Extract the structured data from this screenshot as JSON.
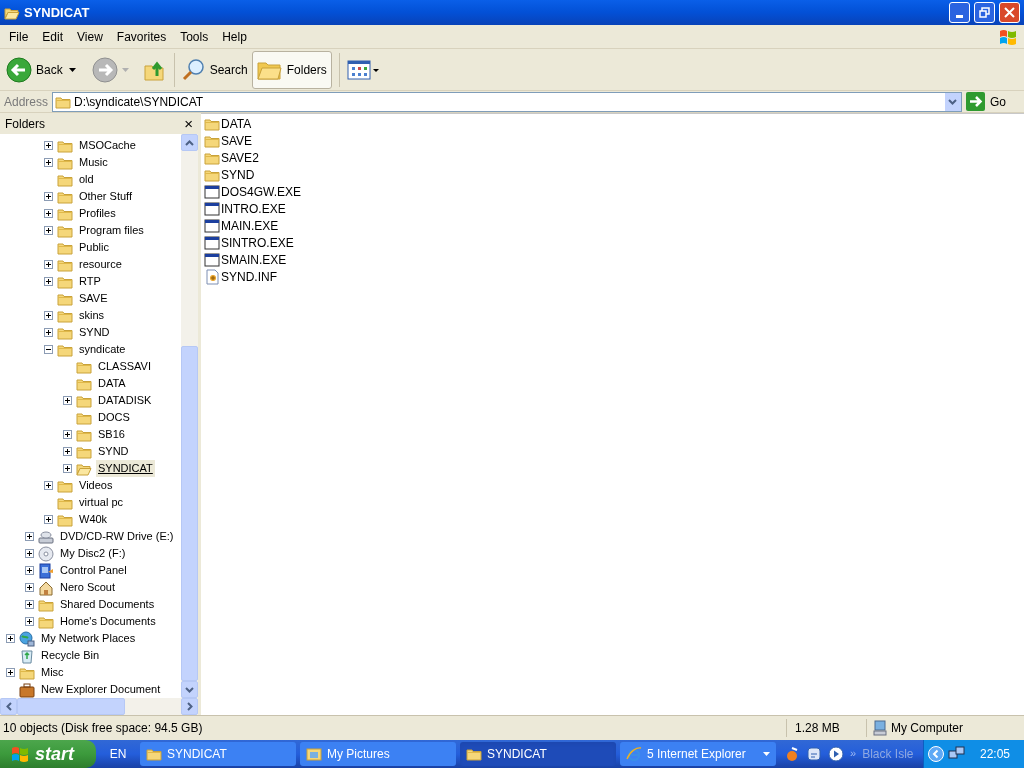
{
  "window": {
    "title": "SYNDICAT"
  },
  "menu": [
    "File",
    "Edit",
    "View",
    "Favorites",
    "Tools",
    "Help"
  ],
  "toolbar": {
    "back": "Back",
    "search": "Search",
    "folders": "Folders",
    "folders_selected": true
  },
  "address": {
    "label": "Address",
    "value": "D:\\syndicate\\SYNDICAT",
    "go": "Go"
  },
  "folders_pane": {
    "title": "Folders",
    "close": "×"
  },
  "tree": [
    {
      "children": [
        {
          "children": [
            {
              "label": "MSOCache",
              "kind": "folder",
              "expandable": true,
              "expanded": false,
              "selected": false
            },
            {
              "label": "Music",
              "kind": "folder",
              "expandable": true,
              "expanded": false,
              "selected": false
            },
            {
              "label": "old",
              "kind": "folder",
              "expandable": false,
              "selected": false
            },
            {
              "label": "Other Stuff",
              "kind": "folder",
              "expandable": true,
              "expanded": false,
              "selected": false
            },
            {
              "label": "Profiles",
              "kind": "folder",
              "expandable": true,
              "expanded": false,
              "selected": false
            },
            {
              "label": "Program files",
              "kind": "folder",
              "expandable": true,
              "expanded": false,
              "selected": false
            },
            {
              "label": "Public",
              "kind": "folder",
              "expandable": false,
              "selected": false
            },
            {
              "label": "resource",
              "kind": "folder",
              "expandable": true,
              "expanded": false,
              "selected": false
            },
            {
              "label": "RTP",
              "kind": "folder",
              "expandable": true,
              "expanded": false,
              "selected": false
            },
            {
              "label": "SAVE",
              "kind": "folder",
              "expandable": false,
              "selected": false
            },
            {
              "label": "skins",
              "kind": "folder",
              "expandable": true,
              "expanded": false,
              "selected": false
            },
            {
              "label": "SYND",
              "kind": "folder",
              "expandable": true,
              "expanded": false,
              "selected": false
            },
            {
              "label": "syndicate",
              "kind": "folder",
              "expandable": true,
              "expanded": true,
              "selected": false,
              "children": [
                {
                  "label": "CLASSAVI",
                  "kind": "folder",
                  "expandable": false,
                  "selected": false
                },
                {
                  "label": "DATA",
                  "kind": "folder",
                  "expandable": false,
                  "selected": false
                },
                {
                  "label": "DATADISK",
                  "kind": "folder",
                  "expandable": true,
                  "expanded": false,
                  "selected": false
                },
                {
                  "label": "DOCS",
                  "kind": "folder",
                  "expandable": false,
                  "selected": false
                },
                {
                  "label": "SB16",
                  "kind": "folder",
                  "expandable": true,
                  "expanded": false,
                  "selected": false
                },
                {
                  "label": "SYND",
                  "kind": "folder",
                  "expandable": true,
                  "expanded": false,
                  "selected": false
                },
                {
                  "label": "SYNDICAT",
                  "kind": "folder-open",
                  "expandable": true,
                  "expanded": false,
                  "selected": true
                }
              ]
            },
            {
              "label": "Videos",
              "kind": "folder",
              "expandable": true,
              "expanded": false,
              "selected": false
            },
            {
              "label": "virtual pc",
              "kind": "folder",
              "expandable": false,
              "selected": false
            },
            {
              "label": "W40k",
              "kind": "folder",
              "expandable": true,
              "expanded": false,
              "selected": false
            }
          ]
        },
        {
          "label": "DVD/CD-RW Drive (E:)",
          "kind": "cd-drive",
          "expandable": true,
          "expanded": false,
          "selected": false
        },
        {
          "label": "My Disc2 (F:)",
          "kind": "disc",
          "expandable": true,
          "expanded": false,
          "selected": false
        },
        {
          "label": "Control Panel",
          "kind": "control-panel",
          "expandable": true,
          "expanded": false,
          "selected": false
        },
        {
          "label": "Nero Scout",
          "kind": "house",
          "expandable": true,
          "expanded": false,
          "selected": false
        },
        {
          "label": "Shared Documents",
          "kind": "folder",
          "expandable": true,
          "expanded": false,
          "selected": false
        },
        {
          "label": "Home's Documents",
          "kind": "folder",
          "expandable": true,
          "expanded": false,
          "selected": false
        }
      ]
    },
    {
      "label": "My Network Places",
      "kind": "network",
      "expandable": true,
      "expanded": false,
      "selected": false
    },
    {
      "label": "Recycle Bin",
      "kind": "recycle",
      "expandable": false,
      "selected": false
    },
    {
      "label": "Misc",
      "kind": "folder",
      "expandable": true,
      "expanded": false,
      "selected": false
    },
    {
      "label": "New Explorer Document",
      "kind": "briefcase",
      "expandable": false,
      "selected": false
    }
  ],
  "files": [
    {
      "name": "DATA",
      "kind": "folder"
    },
    {
      "name": "SAVE",
      "kind": "folder"
    },
    {
      "name": "SAVE2",
      "kind": "folder"
    },
    {
      "name": "SYND",
      "kind": "folder"
    },
    {
      "name": "DOS4GW.EXE",
      "kind": "exe"
    },
    {
      "name": "INTRO.EXE",
      "kind": "exe"
    },
    {
      "name": "MAIN.EXE",
      "kind": "exe"
    },
    {
      "name": "SINTRO.EXE",
      "kind": "exe"
    },
    {
      "name": "SMAIN.EXE",
      "kind": "exe"
    },
    {
      "name": "SYND.INF",
      "kind": "inf"
    }
  ],
  "status_bar": {
    "objects": "10 objects (Disk free space: 94.5 GB)",
    "size": "1.28 MB",
    "zone": "My Computer"
  },
  "taskbar": {
    "start": "start",
    "language": "EN",
    "tasks": [
      {
        "label": "SYNDICAT",
        "kind": "folder",
        "selected": false,
        "group": false
      },
      {
        "label": "My Pictures",
        "kind": "pictures",
        "selected": false,
        "group": false
      },
      {
        "label": "SYNDICAT",
        "kind": "folder",
        "selected": true,
        "group": false
      },
      {
        "label": "5 Internet Explorer",
        "kind": "ie",
        "selected": false,
        "group": true
      }
    ],
    "chevron": "»",
    "toolbar_label": "Black Isle",
    "clock": "22:05"
  }
}
